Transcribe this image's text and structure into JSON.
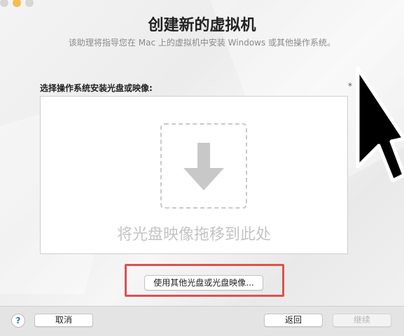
{
  "window": {
    "title": "创建新的虚拟机",
    "subtitle": "该助理将指导您在 Mac 上的虚拟机中安装 Windows 或其他操作系统。"
  },
  "install_source": {
    "label": "选择操作系统安装光盘或映像:",
    "help_marker": "*",
    "drop_hint": "将光盘映像拖移到此处",
    "other_button": "使用其他光盘或光盘映像..."
  },
  "footer": {
    "help_symbol": "?",
    "cancel": "取消",
    "back": "返回",
    "continue": "继续"
  },
  "icons": [
    "download-arrow-icon",
    "mouse-cursor-icon",
    "help-icon"
  ],
  "colors": {
    "highlight_border": "#d9534f",
    "drop_hint_text": "#c4c4c4"
  }
}
